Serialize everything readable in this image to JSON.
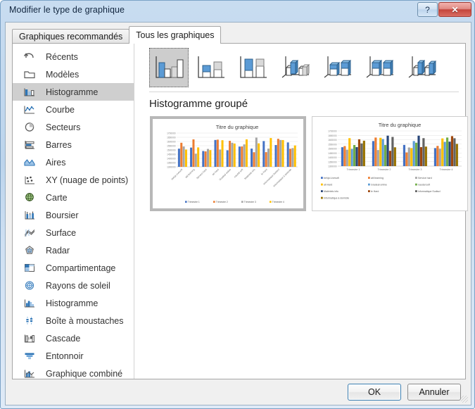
{
  "window": {
    "title": "Modifier le type de graphique",
    "help_button": "?",
    "close_button": "✕"
  },
  "tabs": [
    {
      "label": "Graphiques recommandés",
      "active": false
    },
    {
      "label": "Tous les graphiques",
      "active": true
    }
  ],
  "sidebar": {
    "items": [
      {
        "label": "Récents",
        "icon": "undo-arrow-icon",
        "selected": false
      },
      {
        "label": "Modèles",
        "icon": "folder-icon",
        "selected": false
      },
      {
        "label": "Histogramme",
        "icon": "column-chart-icon",
        "selected": true
      },
      {
        "label": "Courbe",
        "icon": "line-chart-icon",
        "selected": false
      },
      {
        "label": "Secteurs",
        "icon": "pie-chart-icon",
        "selected": false
      },
      {
        "label": "Barres",
        "icon": "bar-chart-icon",
        "selected": false
      },
      {
        "label": "Aires",
        "icon": "area-chart-icon",
        "selected": false
      },
      {
        "label": "XY (nuage de points)",
        "icon": "scatter-chart-icon",
        "selected": false
      },
      {
        "label": "Carte",
        "icon": "map-globe-icon",
        "selected": false
      },
      {
        "label": "Boursier",
        "icon": "stock-chart-icon",
        "selected": false
      },
      {
        "label": "Surface",
        "icon": "surface-chart-icon",
        "selected": false
      },
      {
        "label": "Radar",
        "icon": "radar-chart-icon",
        "selected": false
      },
      {
        "label": "Compartimentage",
        "icon": "treemap-chart-icon",
        "selected": false
      },
      {
        "label": "Rayons de soleil",
        "icon": "sunburst-chart-icon",
        "selected": false
      },
      {
        "label": "Histogramme",
        "icon": "histogram-chart-icon",
        "selected": false
      },
      {
        "label": "Boîte à moustaches",
        "icon": "boxplot-chart-icon",
        "selected": false
      },
      {
        "label": "Cascade",
        "icon": "waterfall-chart-icon",
        "selected": false
      },
      {
        "label": "Entonnoir",
        "icon": "funnel-chart-icon",
        "selected": false
      },
      {
        "label": "Graphique combiné",
        "icon": "combo-chart-icon",
        "selected": false
      }
    ]
  },
  "subtypes": {
    "title": "Histogramme groupé",
    "thumbnails": [
      {
        "name": "histogramme-groupe",
        "selected": true
      },
      {
        "name": "histogramme-empile",
        "selected": false
      },
      {
        "name": "histogramme-empile-100",
        "selected": false
      },
      {
        "name": "histogramme-groupe-3d",
        "selected": false
      },
      {
        "name": "histogramme-empile-3d",
        "selected": false
      },
      {
        "name": "histogramme-empile-100-3d",
        "selected": false
      },
      {
        "name": "histogramme-3d",
        "selected": false
      }
    ]
  },
  "previews": [
    {
      "name": "preview-by-company",
      "selected": true
    },
    {
      "name": "preview-by-quarter",
      "selected": false
    }
  ],
  "colors": {
    "accent_blue": "#4472c4",
    "orange": "#ed7d31",
    "gray": "#a5a5a5",
    "yellow": "#ffc000",
    "light_blue": "#5b9bd5",
    "green": "#70ad47",
    "dark_blue": "#264478",
    "dark_orange": "#9e480e",
    "dark_gray": "#636363",
    "dark_yellow": "#997300",
    "title_bar_start": "#c8dcf0",
    "selection_gray": "#cfcfcf",
    "ok_border": "#3c7fb1"
  },
  "footer": {
    "ok_label": "OK",
    "cancel_label": "Annuler"
  },
  "chart_data": [
    {
      "name": "preview-by-company",
      "type": "bar",
      "title": "Titre du graphique",
      "xlabel": "",
      "ylabel": "",
      "ylim": [
        1300000,
        1700000
      ],
      "yticks": [
        1300000,
        1350000,
        1400000,
        1450000,
        1500000,
        1550000,
        1600000,
        1650000,
        1700000
      ],
      "grid": true,
      "legend_position": "bottom",
      "categories": [
        "behja Livesoft",
        "atil learning",
        "Service hard",
        "ati Hard",
        "Gradeal online",
        "naudal soft",
        "Matériels info",
        "le Hard",
        "Informatique Sudiscl",
        "Informatique à domicile"
      ],
      "series": [
        {
          "name": "Trimestre 1",
          "color": "#4472c4",
          "values": [
            1515000,
            1528000,
            1487000,
            1618000,
            1496000,
            1540000,
            1516000,
            1605000,
            1558000,
            1589000
          ]
        },
        {
          "name": "Trimestre 2",
          "color": "#ed7d31",
          "values": [
            1585000,
            1625000,
            1483000,
            1622000,
            1608000,
            1541000,
            1473000,
            1474000,
            1632000,
            1514000
          ]
        },
        {
          "name": "Trimestre 3",
          "color": "#a5a5a5",
          "values": [
            1541000,
            1456000,
            1512000,
            1505000,
            1585000,
            1566000,
            1646000,
            1516000,
            1618000,
            1522000
          ]
        },
        {
          "name": "Trimestre 4",
          "color": "#ffc000",
          "values": [
            1505000,
            1530000,
            1498000,
            1615000,
            1576000,
            1625000,
            1578000,
            1641000,
            1617000,
            1553000
          ]
        }
      ]
    },
    {
      "name": "preview-by-quarter",
      "type": "bar",
      "title": "Titre du graphique",
      "xlabel": "",
      "ylabel": "",
      "ylim": [
        1300000,
        1700000
      ],
      "yticks": [
        1300000,
        1350000,
        1400000,
        1450000,
        1500000,
        1550000,
        1600000,
        1650000,
        1700000
      ],
      "grid": true,
      "legend_position": "bottom",
      "categories": [
        "Trimestre 1",
        "Trimestre 2",
        "Trimestre 3",
        "Trimestre 4"
      ],
      "series": [
        {
          "name": "behja Livesoft",
          "color": "#4472c4",
          "values": [
            1515000,
            1585000,
            1541000,
            1505000
          ]
        },
        {
          "name": "atil learning",
          "color": "#ed7d31",
          "values": [
            1528000,
            1625000,
            1456000,
            1530000
          ]
        },
        {
          "name": "Service hard",
          "color": "#a5a5a5",
          "values": [
            1487000,
            1483000,
            1512000,
            1498000
          ]
        },
        {
          "name": "ati Hard",
          "color": "#ffc000",
          "values": [
            1618000,
            1622000,
            1505000,
            1615000
          ]
        },
        {
          "name": "Gradeal online",
          "color": "#5b9bd5",
          "values": [
            1496000,
            1608000,
            1585000,
            1576000
          ]
        },
        {
          "name": "naudal soft",
          "color": "#70ad47",
          "values": [
            1540000,
            1541000,
            1566000,
            1625000
          ]
        },
        {
          "name": "Matériels info",
          "color": "#264478",
          "values": [
            1516000,
            1646000,
            1646000,
            1578000
          ]
        },
        {
          "name": "le Hard",
          "color": "#9e480e",
          "values": [
            1605000,
            1474000,
            1516000,
            1641000
          ]
        },
        {
          "name": "Informatique Sudiscl",
          "color": "#636363",
          "values": [
            1558000,
            1632000,
            1618000,
            1617000
          ]
        },
        {
          "name": "Informatique à domicile",
          "color": "#997300",
          "values": [
            1589000,
            1514000,
            1522000,
            1553000
          ]
        }
      ]
    }
  ]
}
